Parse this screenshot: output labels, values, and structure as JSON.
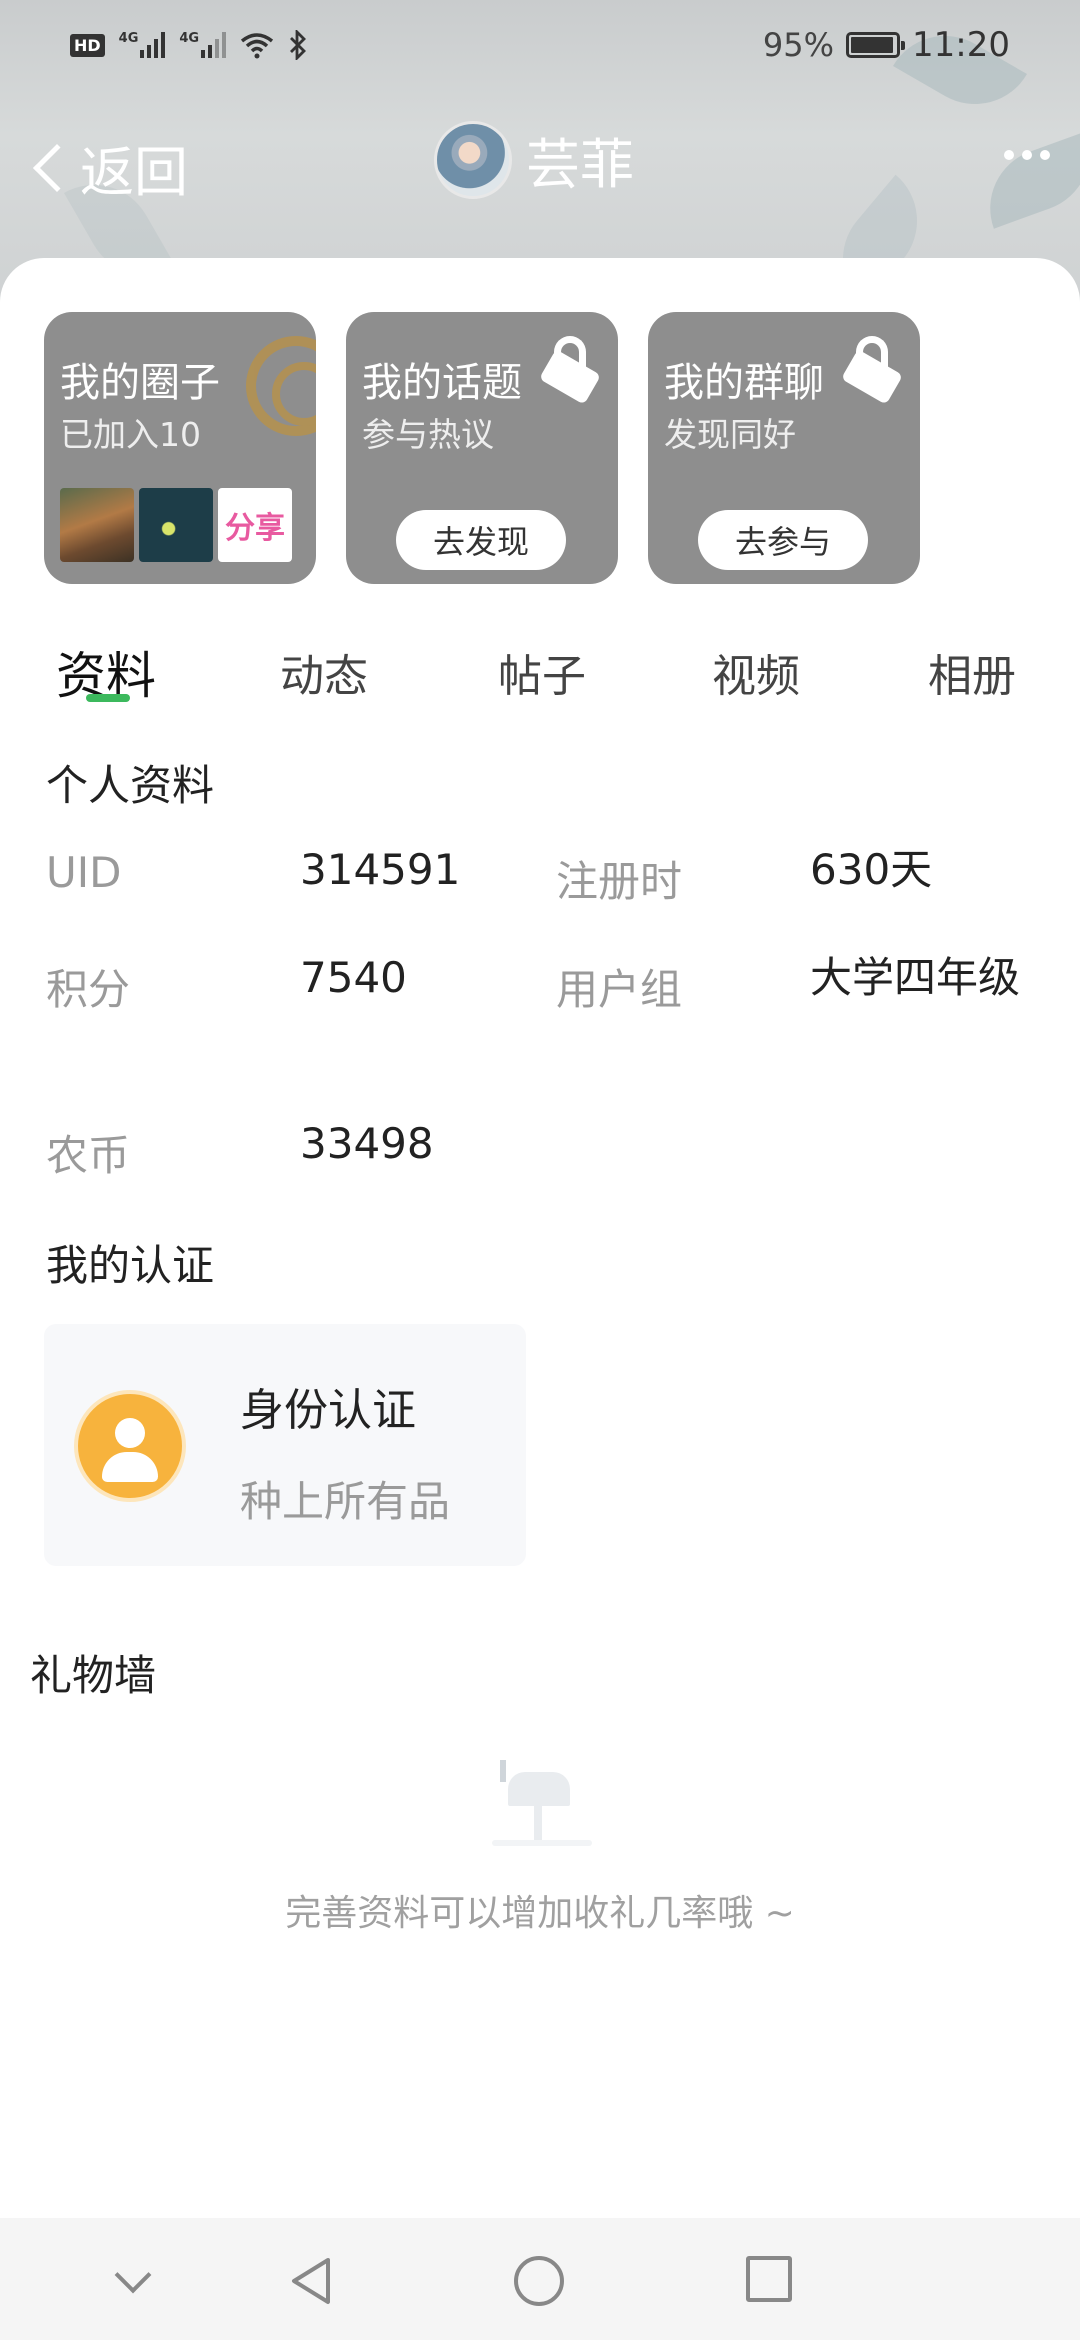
{
  "status_bar": {
    "hd_label": "HD",
    "network_1": "4G",
    "network_2": "4G",
    "battery_percent": "95%",
    "battery_level": 0.95,
    "time": "11:20"
  },
  "nav": {
    "back_label": "返回",
    "profile_name": "芸菲",
    "more_icon": "more-icon"
  },
  "tiles": [
    {
      "title": "我的圈子",
      "subtitle": "已加入10",
      "thumb_share_text": "分享"
    },
    {
      "title": "我的话题",
      "subtitle": "参与热议",
      "button": "去发现"
    },
    {
      "title": "我的群聊",
      "subtitle": "发现同好",
      "button": "去参与"
    }
  ],
  "tabs": [
    "资料",
    "动态",
    "帖子",
    "视频",
    "相册"
  ],
  "active_tab": 0,
  "accent_color": "#3cb95d",
  "profile": {
    "section_title": "个人资料",
    "fields": [
      {
        "label": "UID",
        "value": "314591"
      },
      {
        "label": "注册时",
        "value": "630天"
      },
      {
        "label": "积分",
        "value": "7540"
      },
      {
        "label": "用户组",
        "value": "大学四年级"
      },
      {
        "label": "农币",
        "value": "33498"
      }
    ]
  },
  "certification": {
    "section_title": "我的认证",
    "card_title": "身份认证",
    "card_subtitle": "种上所有品"
  },
  "gift_wall": {
    "section_title": "礼物墙",
    "empty_text": "完善资料可以增加收礼几率哦 ~"
  }
}
